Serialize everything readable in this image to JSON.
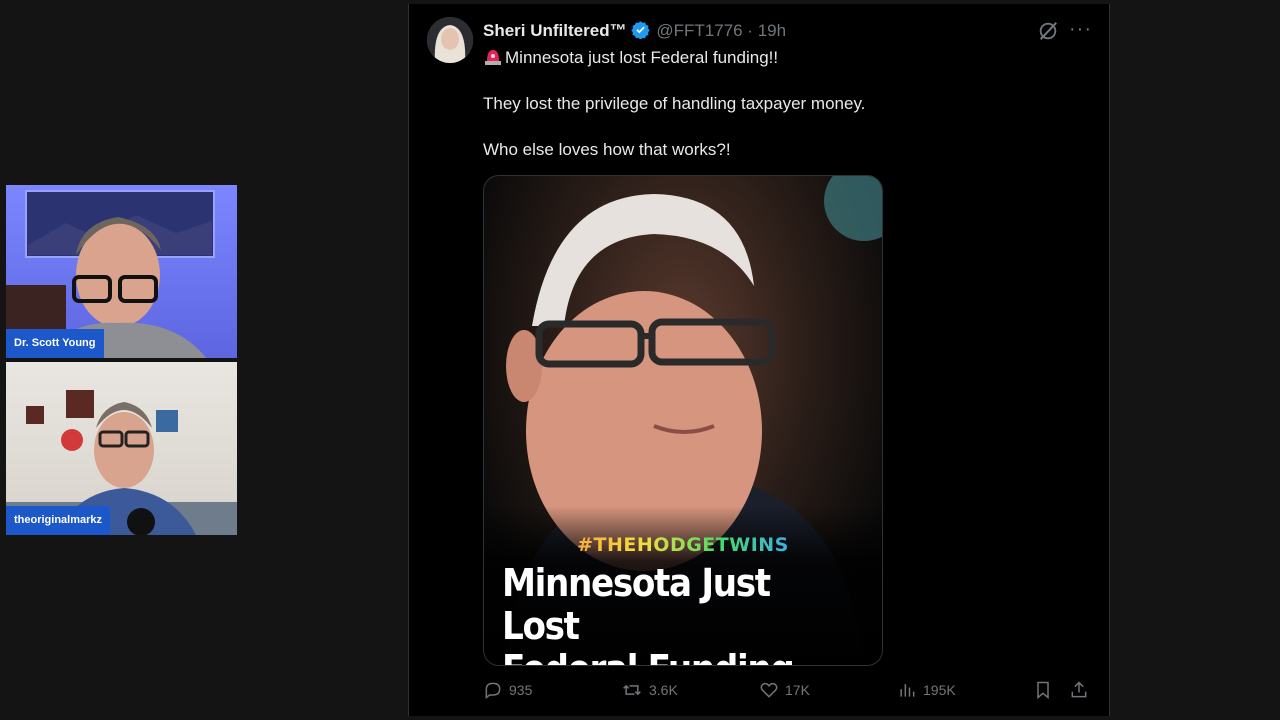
{
  "call": {
    "participants": [
      {
        "name": "Dr. Scott Young"
      },
      {
        "name": "theoriginalmarkz"
      }
    ]
  },
  "tweet": {
    "display_name": "Sheri Unfiltered™",
    "handle": "@FFT1776",
    "separator": "·",
    "time": "19h",
    "lines": [
      "Minnesota just lost Federal funding!!",
      "They lost the privilege of handling taxpayer money.",
      "Who else loves how that works?!"
    ],
    "media": {
      "tag": "#THEHODGETWINS",
      "headline_line1": "Minnesota Just Lost",
      "headline_line2": "Federal Funding"
    },
    "stats": {
      "replies": "935",
      "reposts": "3.6K",
      "likes": "17K",
      "views": "195K"
    },
    "icons": {
      "verified": "verified-badge-icon",
      "siren": "siren-emoji-icon",
      "grok": "grok-icon",
      "more": "more-icon",
      "reply": "reply-icon",
      "repost": "repost-icon",
      "like": "heart-icon",
      "views": "views-chart-icon",
      "bookmark": "bookmark-icon",
      "share": "share-icon"
    },
    "colors": {
      "verified": "#1d9bf0",
      "muted": "#71767b",
      "text": "#e7e9ea",
      "background": "#000000"
    }
  }
}
